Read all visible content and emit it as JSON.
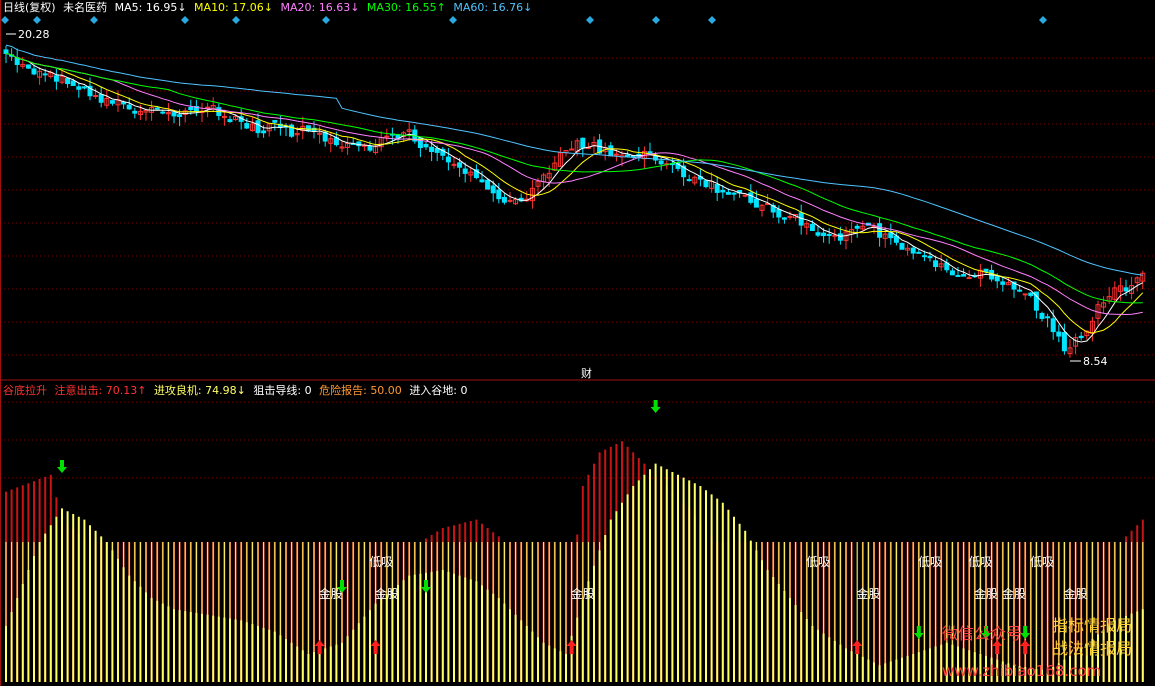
{
  "header": {
    "period": "日线(复权)",
    "stock": "未名医药",
    "ma5_label": "MA5:",
    "ma5_value": "16.95↓",
    "ma10_label": "MA10:",
    "ma10_value": "17.06↓",
    "ma20_label": "MA20:",
    "ma20_value": "16.63↓",
    "ma30_label": "MA30:",
    "ma30_value": "16.55↑",
    "ma60_label": "MA60:",
    "ma60_value": "16.76↓"
  },
  "indicator_header": {
    "name": "谷底拉升",
    "f1_label": "注意出击:",
    "f1_value": "70.13↑",
    "f2_label": "进攻良机:",
    "f2_value": "74.98↓",
    "f3_label": "狙击导线:",
    "f3_value": "0",
    "f4_label": "危险报告:",
    "f4_value": "50.00",
    "f5_label": "进入谷地:",
    "f5_value": "0"
  },
  "price_labels": {
    "high": "20.28",
    "low": "8.54",
    "finance_marker": "财"
  },
  "signal_labels": {
    "gold": "金股",
    "dip": "低吸"
  },
  "watermark": {
    "line1_a": "微信公众号",
    "line1_b": "指标情报局",
    "line2": "战法情报局",
    "line3": "www.zhibiao168.com"
  },
  "colors": {
    "background": "#000000",
    "up": "#ff3232",
    "down": "#00e5ff",
    "ma5": "#ffffff",
    "ma10": "#ffff00",
    "ma20": "#ff80ff",
    "ma30": "#00ff00",
    "ma60": "#4fc3ff",
    "bar_red": "#c81414",
    "bar_yellow": "#ffff66",
    "arrow_green": "#00e000",
    "arrow_red": "#ff2020",
    "header_red": "#ff3232",
    "header_yellow": "#ffff66"
  },
  "chart_data": [
    {
      "type": "candlestick",
      "title": "",
      "ylim": [
        8.54,
        20.28
      ],
      "price_high": 20.28,
      "price_low": 8.54,
      "close_path": [
        [
          0,
          19.6
        ],
        [
          3,
          19.2
        ],
        [
          6,
          18.9
        ],
        [
          9,
          18.8
        ],
        [
          12,
          18.6
        ],
        [
          15,
          18.1
        ],
        [
          18,
          18.0
        ],
        [
          21,
          17.8
        ],
        [
          24,
          17.5
        ],
        [
          27,
          17.7
        ],
        [
          30,
          17.3
        ],
        [
          33,
          17.5
        ],
        [
          36,
          17.8
        ],
        [
          39,
          17.4
        ],
        [
          42,
          17.2
        ],
        [
          45,
          16.9
        ],
        [
          48,
          17.1
        ],
        [
          51,
          16.8
        ],
        [
          54,
          16.9
        ],
        [
          57,
          16.5
        ],
        [
          60,
          16.4
        ],
        [
          63,
          16.2
        ],
        [
          66,
          16.4
        ],
        [
          69,
          16.7
        ],
        [
          72,
          16.8
        ],
        [
          75,
          16.2
        ],
        [
          78,
          15.9
        ],
        [
          81,
          15.5
        ],
        [
          84,
          15.1
        ],
        [
          87,
          14.6
        ],
        [
          90,
          14.3
        ],
        [
          93,
          14.5
        ],
        [
          96,
          15.2
        ],
        [
          99,
          16.0
        ],
        [
          102,
          16.4
        ],
        [
          105,
          16.3
        ],
        [
          108,
          16.1
        ],
        [
          111,
          16.0
        ],
        [
          114,
          16.0
        ],
        [
          117,
          15.8
        ],
        [
          120,
          15.4
        ],
        [
          123,
          15.1
        ],
        [
          126,
          14.9
        ],
        [
          129,
          14.6
        ],
        [
          132,
          14.4
        ],
        [
          135,
          14.2
        ],
        [
          138,
          13.9
        ],
        [
          141,
          13.7
        ],
        [
          144,
          13.3
        ],
        [
          147,
          13.0
        ],
        [
          150,
          13.1
        ],
        [
          153,
          13.4
        ],
        [
          156,
          13.2
        ],
        [
          159,
          12.8
        ],
        [
          162,
          12.5
        ],
        [
          165,
          12.2
        ],
        [
          168,
          11.8
        ],
        [
          171,
          11.5
        ],
        [
          174,
          11.7
        ],
        [
          177,
          11.6
        ],
        [
          180,
          11.2
        ],
        [
          183,
          10.8
        ],
        [
          186,
          10.0
        ],
        [
          189,
          9.1
        ],
        [
          192,
          9.4
        ],
        [
          195,
          10.5
        ],
        [
          198,
          11.1
        ],
        [
          201,
          11.3
        ],
        [
          203,
          11.6
        ]
      ],
      "ma_series": [
        {
          "name": "MA5",
          "value": 16.95
        },
        {
          "name": "MA10",
          "value": 17.06
        },
        {
          "name": "MA20",
          "value": 16.63
        },
        {
          "name": "MA30",
          "value": 16.55
        },
        {
          "name": "MA60",
          "value": 16.76
        }
      ]
    },
    {
      "type": "bar",
      "title": "谷底拉升",
      "ylim": [
        0,
        100
      ],
      "values": {
        "注意出击": 70.13,
        "进攻良机": 74.98,
        "狙击导线": 0,
        "危险报告": 50.0,
        "进入谷地": 0
      },
      "red_profile": [
        [
          0,
          68
        ],
        [
          8,
          74
        ],
        [
          10,
          58
        ],
        [
          16,
          48
        ],
        [
          22,
          40
        ],
        [
          28,
          30
        ],
        [
          32,
          22
        ],
        [
          36,
          18
        ],
        [
          40,
          28
        ],
        [
          46,
          25
        ],
        [
          50,
          20
        ],
        [
          55,
          12
        ],
        [
          60,
          18
        ],
        [
          66,
          32
        ],
        [
          70,
          42
        ],
        [
          74,
          50
        ],
        [
          78,
          55
        ],
        [
          84,
          58
        ],
        [
          88,
          52
        ],
        [
          92,
          40
        ],
        [
          96,
          30
        ],
        [
          100,
          18
        ],
        [
          103,
          70
        ],
        [
          106,
          82
        ],
        [
          110,
          86
        ],
        [
          114,
          78
        ],
        [
          118,
          70
        ],
        [
          122,
          62
        ],
        [
          126,
          52
        ],
        [
          130,
          42
        ],
        [
          134,
          30
        ],
        [
          138,
          20
        ],
        [
          144,
          14
        ],
        [
          148,
          6
        ],
        [
          152,
          0
        ],
        [
          158,
          6
        ],
        [
          164,
          16
        ],
        [
          170,
          22
        ],
        [
          176,
          28
        ],
        [
          182,
          30
        ],
        [
          186,
          22
        ],
        [
          190,
          12
        ],
        [
          196,
          30
        ],
        [
          200,
          52
        ],
        [
          203,
          58
        ]
      ],
      "yellow_profile": [
        [
          0,
          20
        ],
        [
          6,
          50
        ],
        [
          10,
          62
        ],
        [
          14,
          58
        ],
        [
          18,
          50
        ],
        [
          22,
          38
        ],
        [
          26,
          30
        ],
        [
          30,
          26
        ],
        [
          36,
          24
        ],
        [
          42,
          22
        ],
        [
          48,
          18
        ],
        [
          54,
          10
        ],
        [
          60,
          14
        ],
        [
          66,
          28
        ],
        [
          72,
          38
        ],
        [
          78,
          40
        ],
        [
          84,
          36
        ],
        [
          88,
          30
        ],
        [
          92,
          22
        ],
        [
          96,
          14
        ],
        [
          100,
          10
        ],
        [
          104,
          36
        ],
        [
          108,
          58
        ],
        [
          112,
          70
        ],
        [
          116,
          78
        ],
        [
          120,
          74
        ],
        [
          124,
          70
        ],
        [
          128,
          64
        ],
        [
          132,
          54
        ],
        [
          136,
          40
        ],
        [
          140,
          30
        ],
        [
          144,
          20
        ],
        [
          150,
          12
        ],
        [
          156,
          6
        ],
        [
          162,
          10
        ],
        [
          168,
          14
        ],
        [
          174,
          10
        ],
        [
          180,
          6
        ],
        [
          186,
          4
        ],
        [
          192,
          12
        ],
        [
          198,
          22
        ],
        [
          203,
          26
        ]
      ],
      "danger_line": 50.0,
      "signals": [
        {
          "kind": "green_down",
          "bar": 10
        },
        {
          "kind": "green_down",
          "bar": 60
        },
        {
          "kind": "green_down",
          "bar": 75
        },
        {
          "kind": "green_down",
          "bar": 116
        },
        {
          "kind": "green_down",
          "bar": 163
        },
        {
          "kind": "green_down",
          "bar": 175
        },
        {
          "kind": "green_down",
          "bar": 182
        },
        {
          "kind": "red_up",
          "bar": 56
        },
        {
          "kind": "red_up",
          "bar": 66
        },
        {
          "kind": "red_up",
          "bar": 101
        },
        {
          "kind": "red_up",
          "bar": 152
        },
        {
          "kind": "red_up",
          "bar": 177
        },
        {
          "kind": "red_up",
          "bar": 182
        }
      ],
      "text_signals": [
        {
          "label": "gold",
          "bar": 58
        },
        {
          "label": "gold",
          "bar": 68
        },
        {
          "label": "dip",
          "bar": 67
        },
        {
          "label": "gold",
          "bar": 103
        },
        {
          "label": "gold",
          "bar": 154
        },
        {
          "label": "dip",
          "bar": 145
        },
        {
          "label": "dip",
          "bar": 165
        },
        {
          "label": "dip",
          "bar": 174
        },
        {
          "label": "gold",
          "bar": 175
        },
        {
          "label": "gold",
          "bar": 180
        },
        {
          "label": "dip",
          "bar": 185
        },
        {
          "label": "gold",
          "bar": 191
        }
      ]
    }
  ]
}
